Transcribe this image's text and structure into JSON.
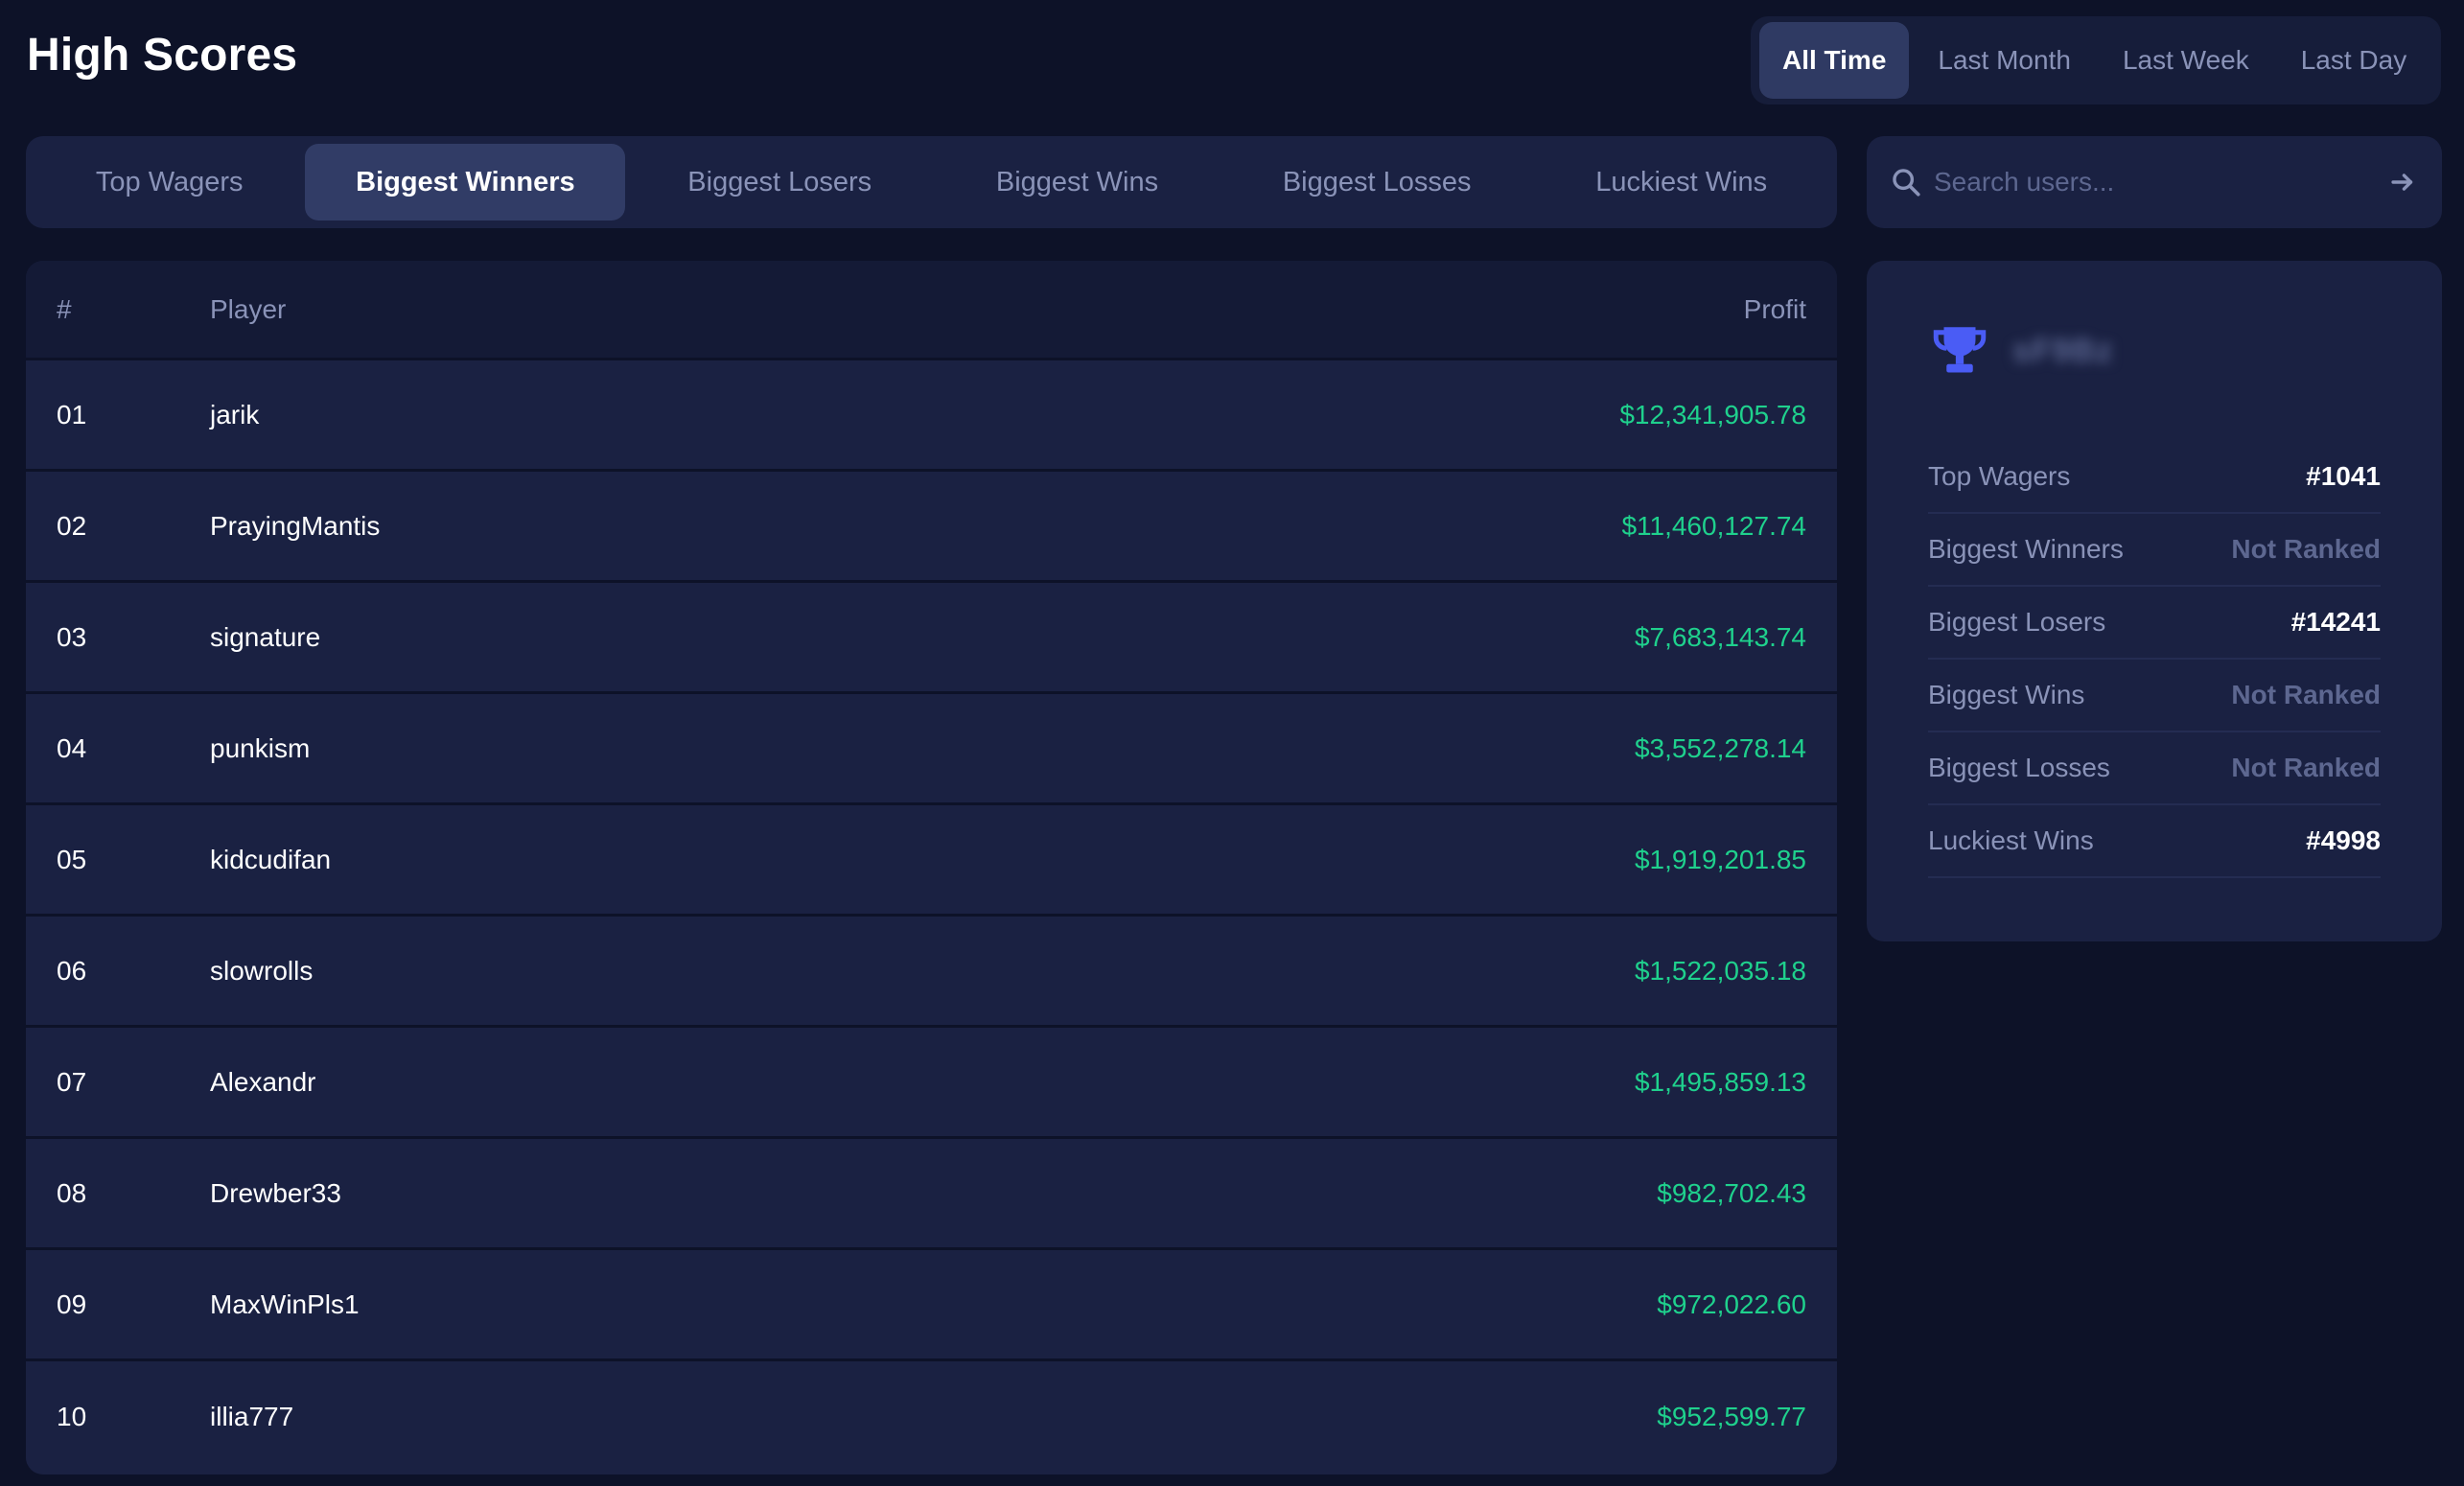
{
  "header": {
    "title": "High Scores"
  },
  "periods": [
    {
      "label": "All Time",
      "active": true
    },
    {
      "label": "Last Month",
      "active": false
    },
    {
      "label": "Last Week",
      "active": false
    },
    {
      "label": "Last Day",
      "active": false
    }
  ],
  "categories": [
    {
      "label": "Top Wagers",
      "active": false
    },
    {
      "label": "Biggest Winners",
      "active": true
    },
    {
      "label": "Biggest Losers",
      "active": false
    },
    {
      "label": "Biggest Wins",
      "active": false
    },
    {
      "label": "Biggest Losses",
      "active": false
    },
    {
      "label": "Luckiest Wins",
      "active": false
    }
  ],
  "search": {
    "placeholder": "Search users...",
    "value": ""
  },
  "table": {
    "headers": {
      "rank": "#",
      "player": "Player",
      "profit": "Profit"
    },
    "rows": [
      {
        "rank": "01",
        "player": "jarik",
        "profit": "$12,341,905.78"
      },
      {
        "rank": "02",
        "player": "PrayingMantis",
        "profit": "$11,460,127.74"
      },
      {
        "rank": "03",
        "player": "signature",
        "profit": "$7,683,143.74"
      },
      {
        "rank": "04",
        "player": "punkism",
        "profit": "$3,552,278.14"
      },
      {
        "rank": "05",
        "player": "kidcudifan",
        "profit": "$1,919,201.85"
      },
      {
        "rank": "06",
        "player": "slowrolls",
        "profit": "$1,522,035.18"
      },
      {
        "rank": "07",
        "player": "Alexandr",
        "profit": "$1,495,859.13"
      },
      {
        "rank": "08",
        "player": "Drewber33",
        "profit": "$982,702.43"
      },
      {
        "rank": "09",
        "player": "MaxWinPls1",
        "profit": "$972,022.60"
      },
      {
        "rank": "10",
        "player": "illia777",
        "profit": "$952,599.77"
      }
    ]
  },
  "profile": {
    "username": "sF9Bz",
    "rankings": [
      {
        "label": "Top Wagers",
        "value": "#1041",
        "ranked": true
      },
      {
        "label": "Biggest Winners",
        "value": "Not Ranked",
        "ranked": false
      },
      {
        "label": "Biggest Losers",
        "value": "#14241",
        "ranked": true
      },
      {
        "label": "Biggest Wins",
        "value": "Not Ranked",
        "ranked": false
      },
      {
        "label": "Biggest Losses",
        "value": "Not Ranked",
        "ranked": false
      },
      {
        "label": "Luckiest Wins",
        "value": "#4998",
        "ranked": true
      }
    ]
  },
  "colors": {
    "background": "#0d1228",
    "panel": "#1a2142",
    "accent": "#4a5cf5",
    "profit": "#1fd18d",
    "muted_text": "#8a93b8"
  },
  "icons": {
    "search": "search-icon",
    "submit": "arrow-right-icon",
    "trophy": "trophy-icon"
  }
}
